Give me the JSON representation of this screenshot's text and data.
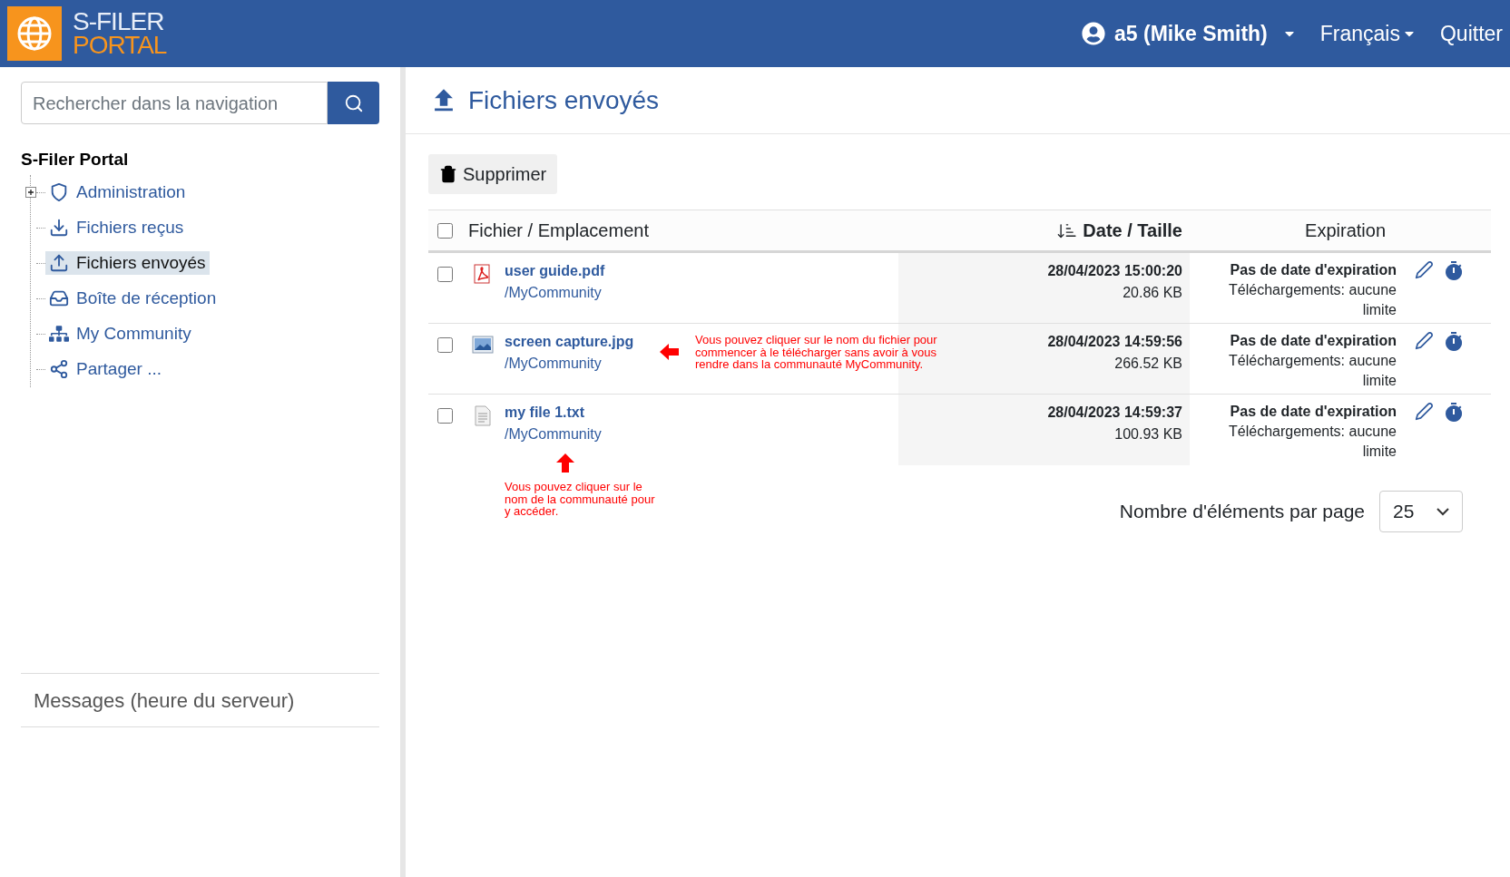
{
  "header": {
    "logo_top": "S-FILER",
    "logo_bottom": "PORTAL",
    "user": "a5 (Mike Smith)",
    "language": "Français",
    "logout": "Quitter"
  },
  "sidebar": {
    "search": {
      "placeholder": "Rechercher dans la navigation"
    },
    "tree": {
      "label": "S-Filer Portal",
      "children": [
        {
          "label": "Administration",
          "kind": "shield",
          "expandable": true,
          "selected": false
        },
        {
          "label": "Fichiers reçus",
          "kind": "download",
          "expandable": false,
          "selected": false
        },
        {
          "label": "Fichiers envoyés",
          "kind": "upload",
          "expandable": false,
          "selected": true
        },
        {
          "label": "Boîte de réception",
          "kind": "inbox",
          "expandable": false,
          "selected": false
        },
        {
          "label": "My Community",
          "kind": "network",
          "expandable": false,
          "selected": false
        },
        {
          "label": "Partager ...",
          "kind": "share",
          "expandable": false,
          "selected": false
        }
      ]
    },
    "messages": "Messages (heure du serveur)"
  },
  "page": {
    "title": "Fichiers envoyés",
    "delete_button": "Supprimer",
    "table": {
      "select_all_checked": false,
      "columns": [
        {
          "label": "Fichier / Emplacement",
          "sorted": false
        },
        {
          "label": "Date / Taille",
          "sorted": true
        },
        {
          "label": "Expiration",
          "sorted": false
        }
      ],
      "rows": [
        {
          "kind": "pdf",
          "checked": false,
          "name": "user guide.pdf",
          "location": "/MyCommunity",
          "date": "28/04/2023 15:00:20",
          "size": "20.86 KB",
          "expiration": "Pas de date d'expiration",
          "downloads": "Téléchargements: aucune limite"
        },
        {
          "kind": "image",
          "checked": false,
          "name": "screen capture.jpg",
          "location": "/MyCommunity",
          "date": "28/04/2023 14:59:56",
          "size": "266.52 KB",
          "expiration": "Pas de date d'expiration",
          "downloads": "Téléchargements: aucune limite"
        },
        {
          "kind": "text",
          "checked": false,
          "name": "my file 1.txt",
          "location": "/MyCommunity",
          "date": "28/04/2023 14:59:37",
          "size": "100.93 KB",
          "expiration": "Pas de date d'expiration",
          "downloads": "Téléchargements: aucune limite"
        }
      ]
    },
    "page_size": {
      "label": "Nombre d'éléments par page",
      "value": "25"
    },
    "annotations": [
      {
        "kind": "left",
        "text": "Vous pouvez cliquer sur le nom du fichier pour commencer à le télécharger sans avoir à vous rendre dans la communauté MyCommunity."
      },
      {
        "kind": "up",
        "text": "Vous pouvez cliquer sur le nom de la communauté pour y accéder."
      }
    ]
  }
}
